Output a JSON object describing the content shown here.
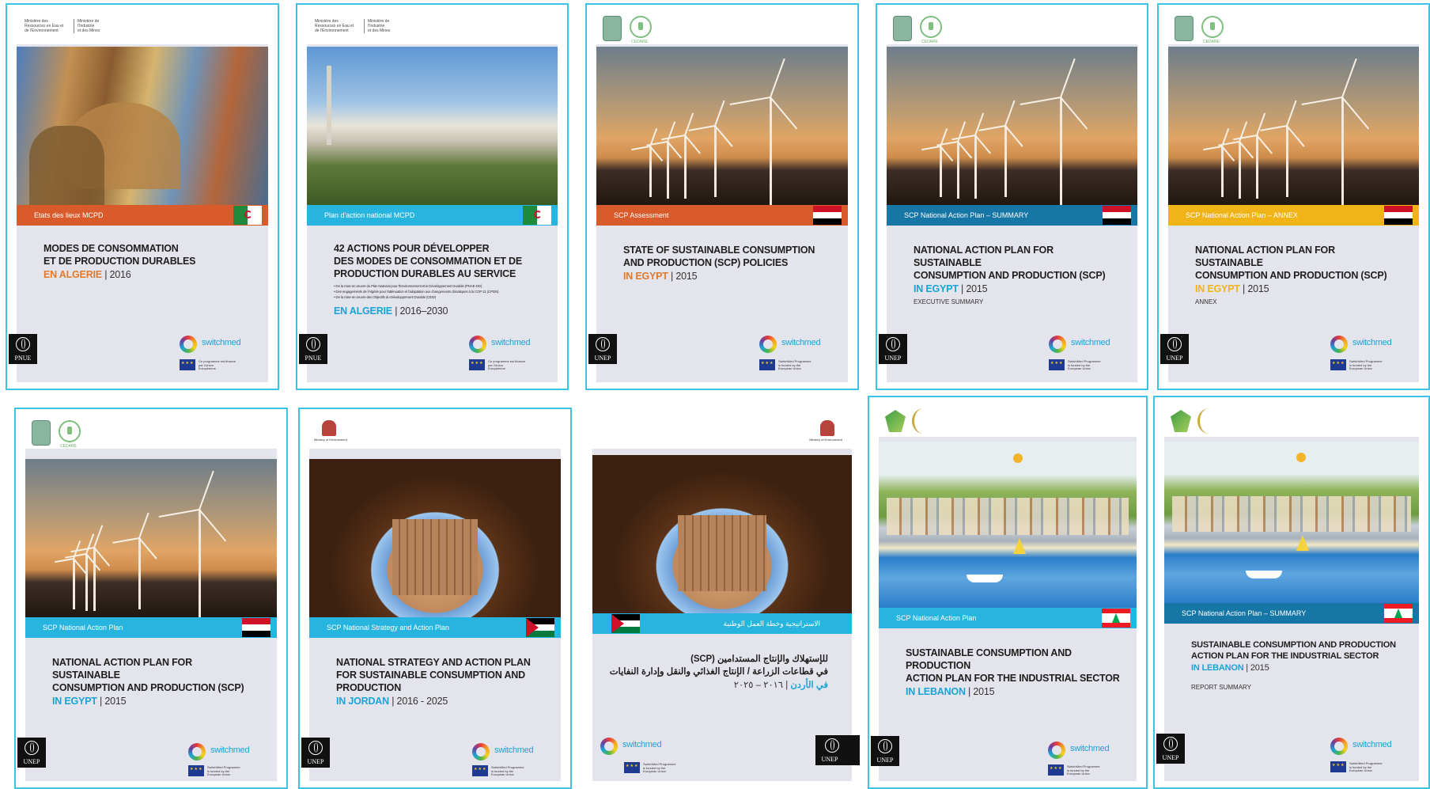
{
  "covers": [
    {
      "ministry_left": "Ministère des\nRessources en Eau et\nde l'Environnement",
      "ministry_right": "Ministère de\nl'Industrie\net des Mines",
      "ribbon": "Etats des lieux MCPD",
      "title": "MODES DE CONSOMMATION\nET DE PRODUCTION DURABLES",
      "country": "EN ALGERIE",
      "years": " | 2016",
      "switch": "switchmed",
      "eu_text": "Ce programme est financé\npar l'Union\nEuropéenne",
      "agency": "PNUE"
    },
    {
      "ministry_left": "Ministère des\nRessources en Eau et\nde l'Environnement",
      "ministry_right": "Ministère de\nl'Industrie\net des Mines",
      "ribbon": "Plan d'action national MCPD",
      "title": "42 ACTIONS POUR DÉVELOPPER\nDES MODES DE CONSOMMATION ET DE\nPRODUCTION DURABLES AU SERVICE",
      "bullets": [
        "• De la mise en œuvre du Plan National pour l'Environnement et le Développement Durable (PNAE-DD)",
        "• Des engagements de l'Algérie pour l'atténuation et l'adaptation aux changements climatiques à la COP 21 (CPDN)",
        "• De la mise en œuvre des Objectifs du Développement Durable (ODD)"
      ],
      "country": "EN ALGERIE",
      "years": " | 2016–2030",
      "switch": "switchmed",
      "eu_text": "Ce programme est financé\npar l'Union\nEuropéenne",
      "agency": "PNUE"
    },
    {
      "emblem_label": "CEDARE",
      "ribbon": "SCP Assessment",
      "title": "STATE OF SUSTAINABLE CONSUMPTION\nAND PRODUCTION (SCP) POLICIES",
      "country": "IN EGYPT",
      "years": " | 2015",
      "switch": "switchmed",
      "eu_text": "SwitchMed Programme\nis funded by the\nEuropean Union",
      "agency": "UNEP"
    },
    {
      "emblem_label": "CEDARE",
      "ribbon": "SCP National Action Plan – SUMMARY",
      "title": "NATIONAL ACTION PLAN FOR SUSTAINABLE\nCONSUMPTION AND PRODUCTION (SCP)",
      "country": "IN EGYPT",
      "years": " | 2015",
      "note": "EXECUTIVE SUMMARY",
      "switch": "switchmed",
      "eu_text": "SwitchMed Programme\nis funded by the\nEuropean Union",
      "agency": "UNEP"
    },
    {
      "emblem_label": "CEDARE",
      "ribbon": "SCP National Action Plan – ANNEX",
      "title": "NATIONAL ACTION PLAN FOR SUSTAINABLE\nCONSUMPTION AND PRODUCTION (SCP)",
      "country": "IN EGYPT",
      "years": " | 2015",
      "note": "ANNEX",
      "switch": "switchmed",
      "eu_text": "SwitchMed Programme\nis funded by the\nEuropean Union",
      "agency": "UNEP"
    },
    {
      "emblem_label": "CEDARE",
      "ribbon": "SCP National Action Plan",
      "title": "NATIONAL ACTION PLAN FOR SUSTAINABLE\nCONSUMPTION AND PRODUCTION (SCP)",
      "country": "IN EGYPT",
      "years": " | 2015",
      "switch": "switchmed",
      "eu_text": "SwitchMed Programme\nis funded by the\nEuropean Union",
      "agency": "UNEP"
    },
    {
      "emblem_label": "Ministry of Environment",
      "ribbon": "SCP National Strategy and Action Plan",
      "title": "NATIONAL STRATEGY AND ACTION PLAN\nFOR SUSTAINABLE CONSUMPTION AND PRODUCTION",
      "country": "IN JORDAN",
      "years": " | 2016 - 2025",
      "switch": "switchmed",
      "eu_text": "SwitchMed Programme\nis funded by the\nEuropean Union",
      "agency": "UNEP"
    },
    {
      "emblem_label": "Ministry of Environment",
      "ribbon": "الاستراتيجية وخطة العمل الوطنية",
      "title": "للإستهلاك والإنتاج المستدامين (SCP)\nفي قطاعات الزراعة / الإنتاج الغذائي والنقل وإدارة النفايات",
      "country": "في الأردن",
      "years": " | ٢٠١٦ – ٢٠٢٥",
      "switch": "switchmed",
      "eu_text": "SwitchMed Programme\nis funded by the\nEuropean Union",
      "agency": "UNEP"
    },
    {
      "ribbon": "SCP National Action Plan",
      "title": "SUSTAINABLE CONSUMPTION AND PRODUCTION\nACTION PLAN FOR THE INDUSTRIAL SECTOR",
      "country": "IN LEBANON",
      "years": " | 2015",
      "switch": "switchmed",
      "eu_text": "SwitchMed Programme\nis funded by the\nEuropean Union",
      "agency": "UNEP"
    },
    {
      "ribbon": "SCP National Action Plan – SUMMARY",
      "title": "SUSTAINABLE CONSUMPTION AND PRODUCTION\nACTION PLAN FOR THE INDUSTRIAL SECTOR",
      "country": "IN LEBANON",
      "years": " | 2015",
      "note": "REPORT SUMMARY",
      "switch": "switchmed",
      "eu_text": "SwitchMed Programme\nis funded by the\nEuropean Union",
      "agency": "UNEP"
    }
  ],
  "colors": {
    "border": "#3ec3e8",
    "ribbon_orange": "#d95a2b",
    "ribbon_cyan": "#27b4de",
    "ribbon_navy": "#1676a6",
    "ribbon_yellow": "#f1b418",
    "country_orange": "#e3792a",
    "country_blue": "#1ba3d6"
  }
}
